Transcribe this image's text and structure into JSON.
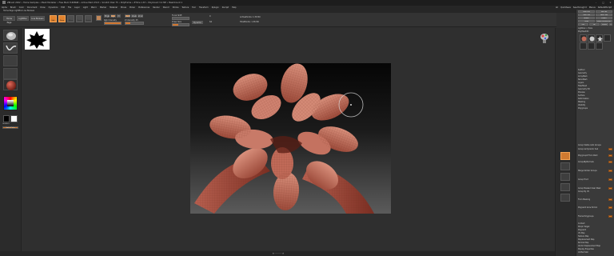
{
  "titlebar": {
    "text": "ZBrush 2022 • Home Samples • Mesh Modeller • Free Mem 8.608GB • Active Mem 2513 • Scratch Disk 75 • PolyFrame • ZTime 1.67 • PolyCount 3.2 MP • MeshCount 1",
    "controls": [
      "–",
      "□",
      "×"
    ]
  },
  "menubar": {
    "items": [
      "Alpha",
      "Brush",
      "Color",
      "Document",
      "Draw",
      "Dynamics",
      "Edit",
      "File",
      "Layer",
      "Light",
      "Macro",
      "Marker",
      "Material",
      "Movie",
      "Picker",
      "Preferences",
      "Render",
      "Stencil",
      "Stroke",
      "Texture",
      "Tool",
      "Transform",
      "Zplugin",
      "Zscript",
      "Help"
    ],
    "quick": [
      "AC",
      "QuickSave",
      "See-through 0",
      "Menus",
      "DefaultZScript"
    ]
  },
  "subbar": {
    "text": "Home Page    LightBox    Live Boolean"
  },
  "toolshelf": {
    "home_label": "Home Page",
    "lightbox_label": "LightBox",
    "liveboolean_label": "Live Boolean",
    "edit_label": "Edit",
    "draw_label": "Draw",
    "move_label": "Move",
    "scale_label": "Scale",
    "rotate_label": "Rotate",
    "mrgb_label": "Mrgb",
    "rgb_label": "Rgb",
    "m_label": "M",
    "zadd_label": "Zadd",
    "zsub_label": "Zsub",
    "zcut_label": "Zcut",
    "focal_label": "Focal Shift",
    "focal_value": "0",
    "drawsize_label": "Draw Size",
    "drawsize_value": "64",
    "dynamic_label": "Dynamic",
    "rgb_intensity_label": "Rgb Intensity",
    "z_intensity_label": "Z Intensity 25",
    "active_points_label": "ActivePoints: 1.36 Mil",
    "total_points_label": "TotalPoints: 1.36 Mil",
    "z_intensity_level": 0.25,
    "draw_size_level": 0.35,
    "rgb_intensity_level": 1.0
  },
  "leftshelf": {
    "buttons": [
      "brush-standard",
      "stroke-freehand",
      "alpha-off",
      "texture-off",
      "material-basic"
    ],
    "color_label": "Gradient",
    "switch_label": "SwitchColor",
    "alternate_label": "Alternate"
  },
  "bottombar": {
    "text": "▲ ─────── ▲"
  },
  "tray": {
    "top_buttons": [
      "Load Tool",
      "Save As",
      "Copy Tool",
      "Paste Tool",
      "Import",
      "Export",
      "Clone",
      "Make PolyMesh3D",
      "GoZ",
      "All",
      "Visible",
      "R"
    ],
    "lightbox_label": "Lightbox > Tools",
    "tool_name": "PolyMesh3D",
    "subtool_items": [
      "Subtool",
      "Geometry",
      "ArrayMesh",
      "NanoMesh",
      "Layers",
      "FiberMesh",
      "Geometry HD",
      "Preview",
      "Surface",
      "Deformation",
      "Masking",
      "Visibility",
      "Polygroups",
      "Contact",
      "Morph Target",
      "Polypaint",
      "UV Map",
      "Texture Map",
      "Displacement Map",
      "Normal Map",
      "Vector Displacement Map",
      "Display Properties",
      "Unified Skin",
      "Initialize",
      "Import",
      "Export"
    ],
    "mid_rows": [
      "Group Visible  Auto Groups",
      "Group As Dynamic Sub",
      "Polygroupit From Paint",
      "GroupsByNormals",
      "Merge Similar Groups",
      "Group Front",
      "Group Masked Clear Mask",
      "Group By UV",
      "From Masking",
      "Polypaint  Grow  Shrink",
      "Frame Polygroups"
    ]
  },
  "colors": {
    "accent": "#e0822e",
    "bg": "#2e2e2e",
    "flower": "#c06a58"
  }
}
